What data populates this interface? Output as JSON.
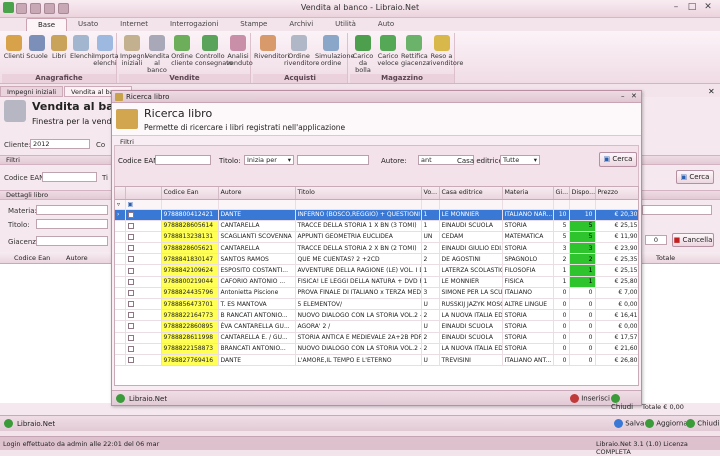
{
  "app": {
    "title": "Vendita al banco - Libraio.Net"
  },
  "ribbon": {
    "tabs": [
      "Base",
      "Usato",
      "Internet",
      "Interrogazioni",
      "Stampe",
      "Archivi",
      "Utilità",
      "Auto"
    ],
    "groups": [
      {
        "title": "Anagrafiche",
        "buttons": [
          "Clienti",
          "Scuole",
          "Libri",
          "Elenchi",
          "Importa elenchi"
        ]
      },
      {
        "title": "Vendite",
        "buttons": [
          "Impegni iniziali",
          "Vendita al banco",
          "Ordine cliente",
          "Controllo consegnato",
          "Analisi venduto"
        ]
      },
      {
        "title": "Acquisti",
        "buttons": [
          "Rivenditori",
          "Ordine rivenditore",
          "Simulazione ordine"
        ]
      },
      {
        "title": "Magazzino",
        "buttons": [
          "Carico da bolla",
          "Carico veloce",
          "Rettifica giacenza",
          "Reso a rivenditore"
        ]
      }
    ]
  },
  "doc_tabs": [
    "Impegni iniziali",
    "Vendita al banco"
  ],
  "background": {
    "title": "Vendita al banco",
    "subtitle": "Finestra per la vendita a",
    "cliente_label": "Cliente:",
    "cliente_value": "2012",
    "co_label": "Co",
    "filtri_label": "Filtri",
    "codice_ean_label": "Codice EAN:",
    "ti_label": "Ti",
    "cerca_label": "Cerca",
    "dettagli_label": "Dettagli libro",
    "materia_label": "Materia:",
    "titolo_label": "Titolo:",
    "giacenza_label": "Giacenza:",
    "qty_value": "0",
    "cancella_label": "Cancella",
    "col_codice_ean": "Codice Ean",
    "col_autore": "Autore",
    "col_totale": "Totale",
    "totale_text": "Totale € 0,00",
    "footer_app": "Libraio.Net",
    "salva_label": "Salva",
    "aggiorna_label": "Aggiorna",
    "chiudi_label": "Chiudi"
  },
  "status": {
    "left": "Login effettuato da admin alle 22:01 del 06 mar",
    "right": "Libraio.Net 3.1 (1.0) Licenza COMPLETA"
  },
  "modal": {
    "window_title": "Ricerca libro",
    "heading": "Ricerca libro",
    "description": "Permette di ricercare i libri registrati nell'applicazione",
    "filtri_label": "Filtri",
    "codice_ean_label": "Codice EAN:",
    "codice_ean_value": "",
    "titolo_label": "Titolo:",
    "titolo_mode": "Inizia per",
    "titolo_value": "",
    "autore_label": "Autore:",
    "autore_value": "ant",
    "casa_editrice_label": "Casa editrice:",
    "casa_editrice_value": "Tutte",
    "cerca_label": "Cerca",
    "footer_app": "Libraio.Net",
    "inserisci_label": "Inserisci",
    "chiudi_label": "Chiudi"
  },
  "grid": {
    "columns": [
      "",
      "Codice Ean",
      "Autore",
      "Titolo",
      "Vo...",
      "Casa editrice",
      "Materia",
      "Gi...",
      "Dispo...",
      "Prezzo"
    ],
    "rows": [
      [
        "9788800412421",
        "DANTE",
        "INFERNO (BOSCO,REGGIO) + QUESTIONI",
        "1",
        "LE MONNIER",
        "ITALIANO NAR...",
        "10",
        "10",
        "€ 20,30"
      ],
      [
        "9788828605614",
        "CANTARELLA",
        "TRACCE DELLA STORIA 1 X BN (3 TOMI)",
        "1",
        "EINAUDI SCUOLA",
        "STORIA",
        "5",
        "5",
        "€ 25,15"
      ],
      [
        "9788813238131",
        "SCAGLIANTI SCOVENNA",
        "APPUNTI GEOMETRIA EUCLIDEA",
        "UN",
        "CEDAM",
        "MATEMATICA",
        "5",
        "5",
        "€ 11,90"
      ],
      [
        "9788828605621",
        "CANTARELLA",
        "TRACCE DELLA STORIA 2 X BN (2 TOMI)",
        "2",
        "EINAUDI GIULIO EDI...",
        "STORIA",
        "3",
        "3",
        "€ 23,90"
      ],
      [
        "9788841830147",
        "SANTOS RAMOS",
        "QUE ME CUENTAS? 2 +2CD",
        "2",
        "DE AGOSTINI",
        "SPAGNOLO",
        "2",
        "2",
        "€ 25,35"
      ],
      [
        "9788842109624",
        "ESPOSITO COSTANTI...",
        "AVVENTURE DELLA RAGIONE (LE) VOL. I DALL...",
        "1",
        "LATERZA SCOLASTICA",
        "FILOSOFIA",
        "1",
        "1",
        "€ 25,15"
      ],
      [
        "9788800219044",
        "CAFORIO ANTONIO ...",
        "FISICA! LE LEGGI DELLA NATURA + DVD ROM...",
        "1",
        "LE MONNIER",
        "FISICA",
        "1",
        "1",
        "€ 25,80"
      ],
      [
        "9788824435796",
        "Antonietta Piscione",
        "PROVA FINALE DI ITALIANO x TERZA MEDIA",
        "3",
        "SIMONE PER LA SCUOLA",
        "ITALIANO",
        "0",
        "0",
        "€ 7,00"
      ],
      [
        "9788856473701",
        "T. ES MANTOVA",
        "5 ELEMENTOV/",
        "U",
        "RUSSKIJ JAZYK MOSCA",
        "ALTRE LINGUE",
        "0",
        "0",
        "€ 0,00"
      ],
      [
        "9788822164773",
        "B RANCATI ANTONIO...",
        "NUOVO DIALOGO CON LA STORIA VOL.2 - VE...",
        "2",
        "LA NUOVA ITALIA ED...",
        "STORIA",
        "0",
        "0",
        "€ 16,41"
      ],
      [
        "9788822860895",
        "ÈVA CANTARELLA GU...",
        "AGORA' 2 /",
        "U",
        "EINAUDI SCUOLA",
        "STORIA",
        "0",
        "0",
        "€ 0,00"
      ],
      [
        "9788828611998",
        "CANTARELLA E. / GU...",
        "STORIA ANTICA E MEDIEVALE 2A+2B PDF/CO...",
        "2",
        "EINAUDI SCUOLA",
        "STORIA",
        "0",
        "0",
        "€ 17,57"
      ],
      [
        "9788822158873",
        "BRANCATI ANTONIO...",
        "NUOVO DIALOGO CON LA STORIA VOL.2 - NA...",
        "2",
        "LA NUOVA ITALIA ED...",
        "STORIA",
        "0",
        "0",
        "€ 21,60"
      ],
      [
        "9788827769416",
        "DANTE",
        "L'AMORE,IL TEMPO E L'ETERNO",
        "U",
        "TREVISINI",
        "ITALIANO ANT...",
        "0",
        "0",
        "€ 26,80"
      ]
    ]
  }
}
